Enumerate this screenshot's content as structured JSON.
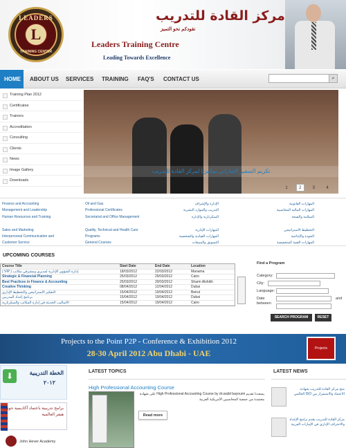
{
  "header": {
    "logo_top": "LEADERS",
    "logo_letter": "L",
    "logo_bottom": "TRAINING CENTER",
    "arabic_title": "مركز القادة للتدريب",
    "arabic_subtitle": "نقودكم نحو التميز",
    "site_name": "Leaders Training Centre",
    "tagline": "Leading Towards Excellence"
  },
  "nav": {
    "items": [
      "HOME",
      "ABOUT US",
      "SERVICES",
      "TRAINING",
      "FAQ'S",
      "CONTACT US"
    ],
    "search_icon": "search-icon"
  },
  "sidebar": {
    "items": [
      "Training Plan 2012",
      "Certificates",
      "Trainers",
      "Accreditation",
      "Consulting",
      "Clients",
      "News",
      "Image Gallery",
      "Downloads"
    ]
  },
  "slider": {
    "caption": "تكريم السفير الإماراتي بماليزيا لمركز القادة للتدريب",
    "pages": [
      "1",
      "2",
      "3",
      "4"
    ],
    "active_page": 1
  },
  "categories": {
    "col1": [
      "Finance and Accounting",
      "Management and Leadership",
      "Human Resources and Training",
      "",
      "Sales and Marketing",
      "Interpersonal Communication and",
      "Customer Service"
    ],
    "col2": [
      "Oil and Gas",
      "Professional Certificates",
      "Secretarial and Office Management",
      "",
      "Quality, Technical and Health Care",
      "Programs",
      "General Courses"
    ],
    "col3": [
      "الإدارة والإشراف",
      "التدريب والموارد البشرية",
      "السكرتارية والإدارة",
      "",
      "المهارات الإدارية",
      "المهارات القيادية والشخصية",
      "التسويق والمبيعات"
    ],
    "col4": [
      "المهارات القانونية",
      "المهارات المالية المحاسبية",
      "السلامة والصحة",
      "",
      "التخطيط الاستراتيجي",
      "الجودة والإنتاجية",
      "المهارات الفنية المتخصصة"
    ]
  },
  "courses": {
    "title": "UPCOMING COURSES",
    "headers": [
      "Course Title",
      "Start Date",
      "End Date",
      "Location"
    ],
    "rows": [
      [
        "( VIP ) إدارة الشؤون الإدارية لمديري ومشرفي مكاتب",
        "18/03/2012",
        "22/03/2012",
        "Manama"
      ],
      [
        "Strategic & Financial Planning",
        "25/03/2012",
        "29/03/2012",
        "Cairo"
      ],
      [
        "Best Practices in Finance & Accounting",
        "25/03/2012",
        "29/03/2012",
        "Sharm Alshikh"
      ],
      [
        "Creative Thinking",
        "08/04/2012",
        "12/04/2012",
        "Dubai"
      ],
      [
        "التفكير الاستراتيجي والتخطيط الإداري",
        "15/04/2012",
        "19/04/2012",
        "Beirut"
      ],
      [
        "برنامج إعداد المدربين",
        "15/04/2012",
        "19/04/2012",
        "Dubai"
      ],
      [
        "الأساليب الحديثة في إدارة المكاتب والسكرتارية",
        "15/04/2012",
        "19/04/2012",
        "Cairo"
      ]
    ]
  },
  "find_program": {
    "title": "Find a Program",
    "category_label": "Category:",
    "city_label": "City:",
    "language_label": "Language:",
    "date_label": "Date",
    "between_label": "between",
    "and_label": "and",
    "search_button": "SEARCH PROGRAM",
    "reset_button": "RESET"
  },
  "banner": {
    "line1": "Projects to the Point P2P - Conference & Exhibition 2012",
    "line2": "28-30 April 2012        Abu Dhabi - UAE",
    "badge": "Projects"
  },
  "ads": {
    "plan_title": "الخطة التدريبية",
    "plan_year": "٢٠١٢",
    "academy_text": "برامج تدريبية باعتماد أكاديمية جون هيفر العالمية",
    "academy_name": "John Hever Academy"
  },
  "topics": {
    "heading": "LATEST TOPICS",
    "title": "High Professional Accounting Course",
    "text": "يسعدنا تقديم High Professional Accounting Course by dr.walid bayoumi على شهادة معتمدة من جمعية المحاسبين الأمريكية العربية",
    "read_more": "Read more"
  },
  "news": {
    "heading": "LATEST NEWS",
    "items": [
      "منح مركز القادة للتدريب شهادة الاعتماد والاستمرار من ISO العالمي",
      "مركز القادة للتدريب يقدم برامج الإعداد والاحتراف الإداري في الإمارات العربية"
    ]
  }
}
